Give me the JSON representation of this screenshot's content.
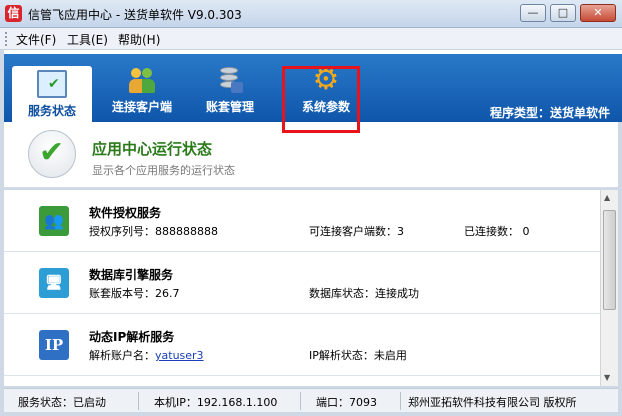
{
  "window": {
    "title": "信管飞应用中心 - 送货单软件 V9.0.303",
    "app_icon": "信",
    "minimize": "—",
    "maximize": "□",
    "close": "✕"
  },
  "menu": {
    "items": [
      "文件(F)",
      "工具(E)",
      "帮助(H)"
    ]
  },
  "toolbar": {
    "tabs": [
      {
        "label": "服务状态",
        "icon": "monitor-check-icon",
        "active": true
      },
      {
        "label": "连接客户端",
        "icon": "users-icon",
        "active": false
      },
      {
        "label": "账套管理",
        "icon": "database-icon",
        "active": false
      },
      {
        "label": "系统参数",
        "icon": "gear-icon",
        "active": false
      }
    ],
    "program_type": "程序类型：送货单软件",
    "gear_glyph": "⚙"
  },
  "status_header": {
    "title": "应用中心运行状态",
    "subtitle": "显示各个应用服务的运行状态",
    "check": "✔"
  },
  "services": [
    {
      "name": "软件授权服务",
      "icon": "users-icon",
      "icon_glyph": "👥",
      "field_a": "授权序列号：888888888",
      "field_b": "可连接客户端数：3",
      "field_c": "已连接数： 0"
    },
    {
      "name": "数据库引擎服务",
      "icon": "database-engine-icon",
      "icon_glyph": "🖥",
      "field_a": "账套版本号：26.7",
      "field_b": "数据库状态：连接成功"
    },
    {
      "name": "动态IP解析服务",
      "icon": "ip-icon",
      "icon_glyph": "IP",
      "field_a_label": "解析账户名：",
      "field_a_link": "yatuser3",
      "field_b": "IP解析状态：未启用"
    }
  ],
  "statusbar": {
    "service_status": "服务状态：已启动",
    "local_ip": "本机IP：192.168.1.100",
    "port": "端口：7093",
    "copyright": "郑州亚拓软件科技有限公司 版权所"
  },
  "colors": {
    "accent_blue": "#1560b4",
    "highlight_red": "#e8141b",
    "status_green": "#2a7a1a"
  }
}
